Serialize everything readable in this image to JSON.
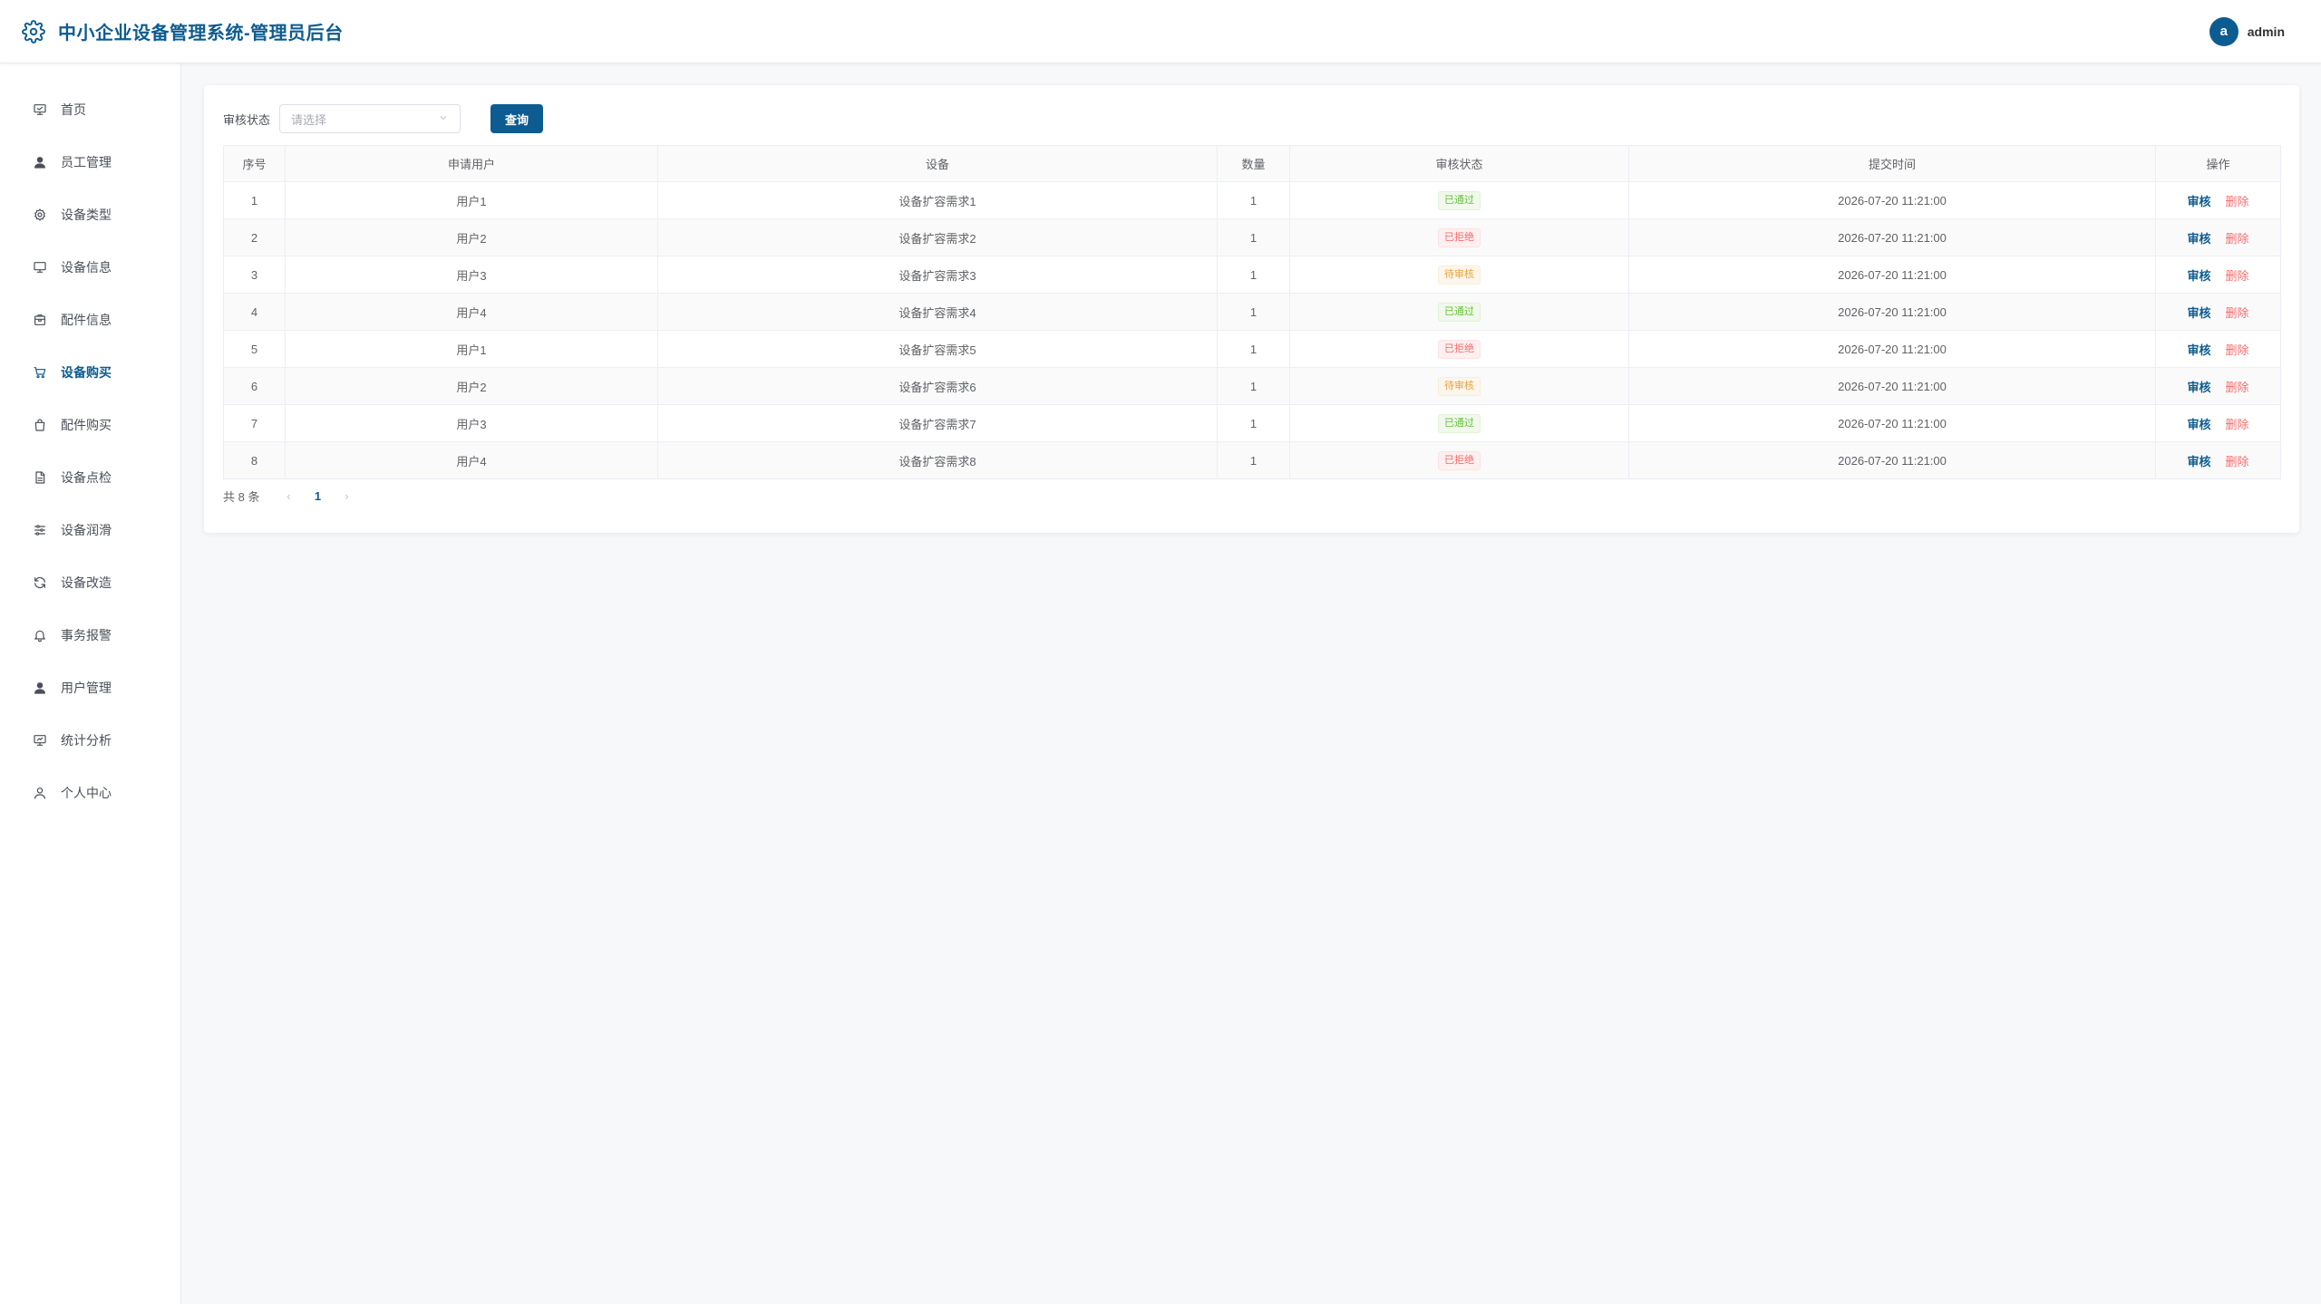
{
  "header": {
    "title": "中小企业设备管理系统-管理员后台",
    "avatar_letter": "a",
    "username": "admin"
  },
  "sidebar": {
    "items": [
      {
        "label": "首页",
        "icon": "dashboard-icon"
      },
      {
        "label": "员工管理",
        "icon": "user-icon"
      },
      {
        "label": "设备类型",
        "icon": "settings-icon"
      },
      {
        "label": "设备信息",
        "icon": "monitor-icon"
      },
      {
        "label": "配件信息",
        "icon": "package-icon"
      },
      {
        "label": "设备购买",
        "icon": "cart-icon",
        "active": true
      },
      {
        "label": "配件购买",
        "icon": "shopping-bag-icon"
      },
      {
        "label": "设备点检",
        "icon": "document-icon"
      },
      {
        "label": "设备润滑",
        "icon": "sliders-icon"
      },
      {
        "label": "设备改造",
        "icon": "refresh-icon"
      },
      {
        "label": "事务报警",
        "icon": "bell-icon"
      },
      {
        "label": "用户管理",
        "icon": "user-icon"
      },
      {
        "label": "统计分析",
        "icon": "chart-icon"
      },
      {
        "label": "个人中心",
        "icon": "user-outline-icon"
      }
    ]
  },
  "filter": {
    "label": "审核状态",
    "placeholder": "请选择",
    "query_label": "查询"
  },
  "table": {
    "headers": [
      "序号",
      "申请用户",
      "设备",
      "数量",
      "审核状态",
      "提交时间",
      "操作"
    ],
    "rows": [
      {
        "no": "1",
        "user": "用户1",
        "device": "设备扩容需求1",
        "qty": "1",
        "status": "已通过",
        "status_type": "ok",
        "time": "2026-07-20 11:21:00"
      },
      {
        "no": "2",
        "user": "用户2",
        "device": "设备扩容需求2",
        "qty": "1",
        "status": "已拒绝",
        "status_type": "reject",
        "time": "2026-07-20 11:21:00"
      },
      {
        "no": "3",
        "user": "用户3",
        "device": "设备扩容需求3",
        "qty": "1",
        "status": "待审核",
        "status_type": "pending",
        "time": "2026-07-20 11:21:00"
      },
      {
        "no": "4",
        "user": "用户4",
        "device": "设备扩容需求4",
        "qty": "1",
        "status": "已通过",
        "status_type": "ok",
        "time": "2026-07-20 11:21:00"
      },
      {
        "no": "5",
        "user": "用户1",
        "device": "设备扩容需求5",
        "qty": "1",
        "status": "已拒绝",
        "status_type": "reject",
        "time": "2026-07-20 11:21:00"
      },
      {
        "no": "6",
        "user": "用户2",
        "device": "设备扩容需求6",
        "qty": "1",
        "status": "待审核",
        "status_type": "pending",
        "time": "2026-07-20 11:21:00"
      },
      {
        "no": "7",
        "user": "用户3",
        "device": "设备扩容需求7",
        "qty": "1",
        "status": "已通过",
        "status_type": "ok",
        "time": "2026-07-20 11:21:00"
      },
      {
        "no": "8",
        "user": "用户4",
        "device": "设备扩容需求8",
        "qty": "1",
        "status": "已拒绝",
        "status_type": "reject",
        "time": "2026-07-20 11:21:00"
      }
    ],
    "actions": {
      "review": "审核",
      "delete": "删除"
    }
  },
  "pagination": {
    "total_text": "共 8 条",
    "current_page": "1"
  },
  "colors": {
    "primary": "#0d5c91",
    "success": "#67c23a",
    "danger": "#f56c6c",
    "warning": "#e6a23c"
  }
}
